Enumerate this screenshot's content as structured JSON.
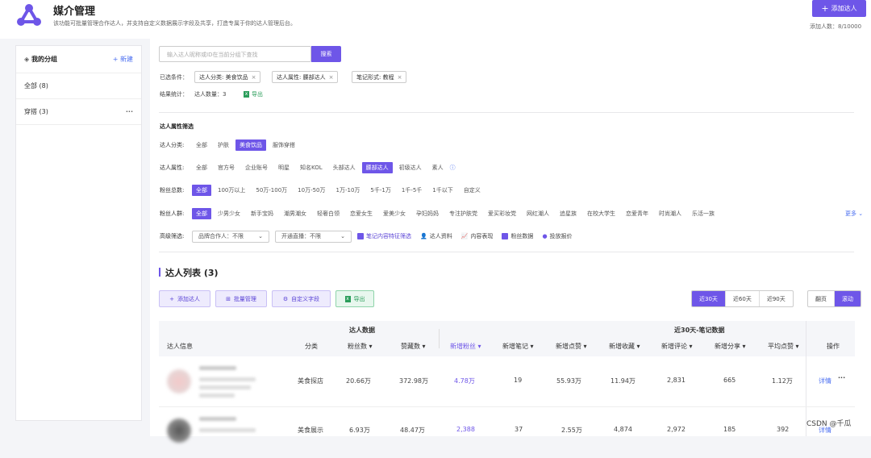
{
  "header": {
    "title": "媒介管理",
    "subtitle": "该功能可批量管理合作达人，并支持自定义数据展示字段及共享，打造专属于你的达人管理后台。",
    "add_button": "添加达人",
    "added_count": "添加人数：8/10000"
  },
  "sidebar": {
    "title": "我的分组",
    "new_label": "+ 新建",
    "items": [
      {
        "label": "全部 (8)"
      },
      {
        "label": "穿搭 (3)",
        "menu": "···"
      }
    ]
  },
  "search": {
    "placeholder": "输入达人昵称或ID在当前分组下查找",
    "button": "搜索"
  },
  "conditions": {
    "label": "已选条件：",
    "tags": [
      "达人分类: 美食饮品",
      "达人属性: 腰部达人",
      "笔记形式: 教程"
    ]
  },
  "stats": {
    "label": "结果统计：",
    "value": "达人数量：3",
    "export": "导出"
  },
  "filters": {
    "section_title": "达人属性筛选",
    "category": {
      "label": "达人分类:",
      "options": [
        "全部",
        "护肤",
        "美食饮品",
        "服饰穿搭"
      ],
      "selected": 2
    },
    "attribute": {
      "label": "达人属性:",
      "options": [
        "全部",
        "官方号",
        "企业账号",
        "明星",
        "知名KOL",
        "头部达人",
        "腰部达人",
        "初级达人",
        "素人"
      ],
      "selected": 6
    },
    "fans": {
      "label": "粉丝总数:",
      "options": [
        "全部",
        "100万以上",
        "50万-100万",
        "10万-50万",
        "1万-10万",
        "5千-1万",
        "1千-5千",
        "1千以下",
        "自定义"
      ],
      "selected": 0
    },
    "crowd": {
      "label": "粉丝人群:",
      "options": [
        "全部",
        "少男少女",
        "新手宝妈",
        "潮男潮女",
        "轻奢白领",
        "恋爱女生",
        "爱美少女",
        "孕妇妈妈",
        "专注护肤党",
        "爱买彩妆党",
        "网红潮人",
        "追星族",
        "在校大学生",
        "恋爱青年",
        "时尚潮人",
        "乐活一族"
      ],
      "selected": 0,
      "more": "更多"
    },
    "advanced": {
      "label": "高级筛选:",
      "selects": [
        "品牌合作人：不限",
        "开通直播：不限"
      ],
      "links": [
        "笔记内容特征筛选",
        "达人资料",
        "内容表现",
        "粉丝数据",
        "投放报价"
      ]
    }
  },
  "list": {
    "title": "达人列表 (3)",
    "actions": [
      "添加达人",
      "批量管理",
      "自定义字段",
      "导出"
    ],
    "ranges": [
      "近30天",
      "近60天",
      "近90天"
    ],
    "range_selected": 0,
    "modes": [
      "翻页",
      "滚动"
    ],
    "mode_selected": 1
  },
  "table": {
    "group_headers": [
      "达人数据",
      "近30天-笔记数据"
    ],
    "headers": [
      "达人信息",
      "分类",
      "粉丝数",
      "赞藏数",
      "新增粉丝",
      "新增笔记",
      "新增点赞",
      "新增收藏",
      "新增评论",
      "新增分享",
      "平均点赞",
      "操作"
    ],
    "rows": [
      [
        "美食探店",
        "20.66万",
        "372.98万",
        "4.78万",
        "19",
        "55.93万",
        "11.94万",
        "2,831",
        "665",
        "1.12万"
      ],
      [
        "美食展示",
        "6.93万",
        "48.47万",
        "2,388",
        "37",
        "2.55万",
        "4,874",
        "2,972",
        "185",
        "392"
      ]
    ],
    "detail_label": "详情",
    "more_label": "···"
  },
  "watermark": "CSDN @千瓜"
}
